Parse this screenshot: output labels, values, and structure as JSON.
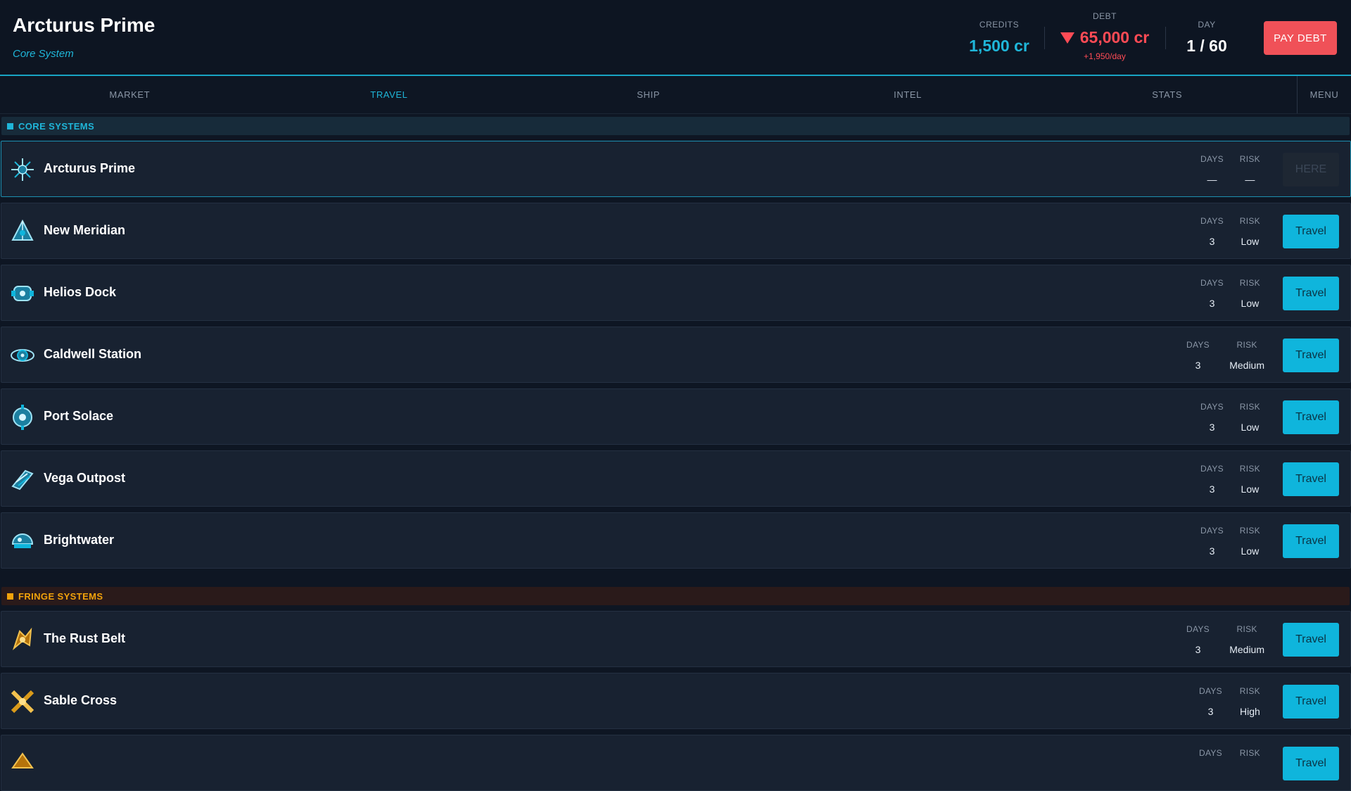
{
  "header": {
    "location_name": "Arcturus Prime",
    "location_type": "Core System",
    "credits_label": "CREDITS",
    "credits_value": "1,500 cr",
    "debt_label": "DEBT",
    "debt_value": "65,000 cr",
    "debt_rate": "+1,950/day",
    "day_label": "DAY",
    "day_value": "1 / 60",
    "pay_debt_label": "PAY DEBT",
    "colors": {
      "accent": "#1fb6d9",
      "debt": "#ff4b55",
      "pay_button": "#f05158"
    }
  },
  "tabs": [
    {
      "label": "MARKET",
      "active": false
    },
    {
      "label": "TRAVEL",
      "active": true
    },
    {
      "label": "SHIP",
      "active": false
    },
    {
      "label": "INTEL",
      "active": false
    },
    {
      "label": "STATS",
      "active": false
    }
  ],
  "menu_label": "MENU",
  "labels": {
    "days": "DAYS",
    "risk": "RISK",
    "travel": "Travel",
    "here": "HERE"
  },
  "sections": [
    {
      "title": "CORE SYSTEMS",
      "color": "#1fb6d9",
      "destinations": [
        {
          "name": "Arcturus Prime",
          "days": "—",
          "risk": "—",
          "current": true,
          "icon": "star-station-icon"
        },
        {
          "name": "New Meridian",
          "days": "3",
          "risk": "Low",
          "current": false,
          "icon": "pyramid-station-icon"
        },
        {
          "name": "Helios Dock",
          "days": "3",
          "risk": "Low",
          "current": false,
          "icon": "dock-station-icon"
        },
        {
          "name": "Caldwell Station",
          "days": "3",
          "risk": "Medium",
          "current": false,
          "icon": "ring-station-icon"
        },
        {
          "name": "Port Solace",
          "days": "3",
          "risk": "Low",
          "current": false,
          "icon": "orb-station-icon"
        },
        {
          "name": "Vega Outpost",
          "days": "3",
          "risk": "Low",
          "current": false,
          "icon": "outpost-icon"
        },
        {
          "name": "Brightwater",
          "days": "3",
          "risk": "Low",
          "current": false,
          "icon": "dome-station-icon"
        }
      ]
    },
    {
      "title": "FRINGE SYSTEMS",
      "color": "#f2a20b",
      "destinations": [
        {
          "name": "The Rust Belt",
          "days": "3",
          "risk": "Medium",
          "current": false,
          "icon": "rust-belt-icon"
        },
        {
          "name": "Sable Cross",
          "days": "3",
          "risk": "High",
          "current": false,
          "icon": "cross-station-icon"
        },
        {
          "name": "",
          "days": "",
          "risk": "",
          "current": false,
          "icon": "fringe-station-icon"
        }
      ]
    }
  ]
}
